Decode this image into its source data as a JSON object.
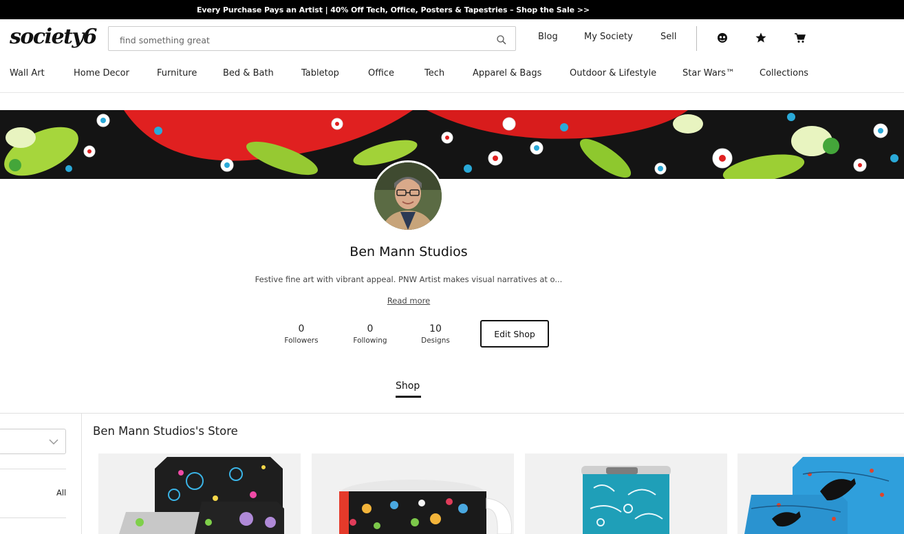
{
  "promo": {
    "text": "Every Purchase Pays an Artist | 40% Off Tech, Office, Posters & Tapestries – Shop the Sale >>"
  },
  "header": {
    "logo": "society6",
    "search_placeholder": "find something great",
    "links": {
      "blog": "Blog",
      "my_society": "My Society",
      "sell": "Sell"
    },
    "icons": [
      "user-icon",
      "star-icon",
      "cart-icon"
    ]
  },
  "nav": {
    "items": [
      "Wall Art",
      "Home Decor",
      "Furniture",
      "Bed & Bath",
      "Tabletop",
      "Office",
      "Tech",
      "Apparel & Bags",
      "Outdoor & Lifestyle",
      "Star Wars™",
      "Collections"
    ]
  },
  "profile": {
    "name": "Ben Mann Studios",
    "bio": "Festive fine art with vibrant appeal. PNW Artist makes visual narratives at o...",
    "read_more": "Read more",
    "stats": {
      "followers": {
        "value": "0",
        "label": "Followers"
      },
      "following": {
        "value": "0",
        "label": "Following"
      },
      "designs": {
        "value": "10",
        "label": "Designs"
      }
    },
    "edit_button": "Edit Shop"
  },
  "tabs": {
    "shop": "Shop"
  },
  "store": {
    "title": "Ben Mann Studios's Store",
    "filter_option": "All"
  },
  "colors": {
    "promo_bg": "#000000",
    "text": "#222222"
  }
}
